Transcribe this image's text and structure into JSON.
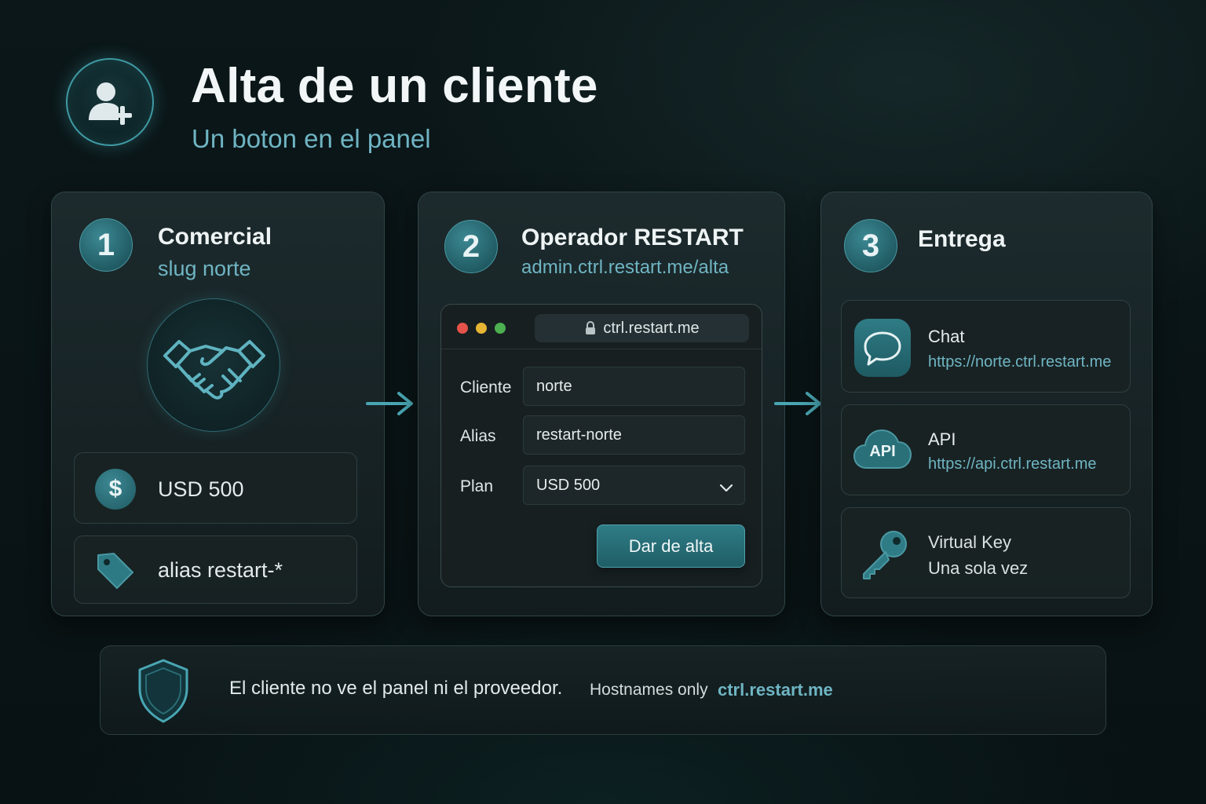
{
  "header": {
    "title": "Alta de un cliente",
    "subtitle": "Un boton en el panel",
    "icon": "user-plus-icon"
  },
  "steps": [
    {
      "number": "1",
      "title": "Comercial",
      "subtitle": "slug norte",
      "illustration": "handshake-icon",
      "items": [
        {
          "icon": "dollar-icon",
          "label": "USD 500"
        },
        {
          "icon": "tag-icon",
          "label": "alias restart-*"
        }
      ]
    },
    {
      "number": "2",
      "title": "Operador RESTART",
      "subtitle": "admin.ctrl.restart.me/alta",
      "browser": {
        "url": "ctrl.restart.me",
        "fields": [
          {
            "label": "Cliente",
            "value": "norte"
          },
          {
            "label": "Alias",
            "value": "restart-norte"
          },
          {
            "label": "Plan",
            "value": "USD 500"
          }
        ],
        "submit_label": "Dar de alta"
      }
    },
    {
      "number": "3",
      "title": "Entrega",
      "items": [
        {
          "icon": "chat-icon",
          "title": "Chat",
          "detail": "https://norte.ctrl.restart.me"
        },
        {
          "icon": "api-cloud-icon",
          "icon_text": "API",
          "title": "API",
          "detail": "https://api.ctrl.restart.me"
        },
        {
          "icon": "key-icon",
          "title": "Virtual Key",
          "detail": "Una sola vez"
        }
      ]
    }
  ],
  "footer": {
    "icon": "shield-icon",
    "note": "El cliente no ve el panel ni el proveedor.",
    "hostnames_label": "Hostnames only",
    "hostname": "ctrl.restart.me"
  },
  "colors": {
    "accent": "#6fb5c3",
    "teal": "#2f7c86",
    "background": "#0a1416"
  }
}
